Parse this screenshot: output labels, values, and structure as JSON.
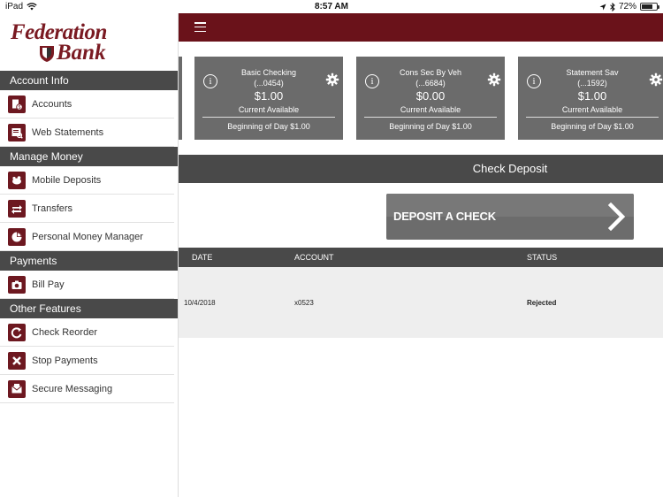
{
  "status_bar": {
    "device": "iPad",
    "time": "8:57 AM",
    "battery": "72%",
    "battery_level": 0.72
  },
  "logo": {
    "line1": "Federation",
    "line2": "Bank"
  },
  "sidebar": {
    "sections": [
      {
        "title": "Account Info",
        "items": [
          {
            "label": "Accounts",
            "icon": "accounts-icon"
          },
          {
            "label": "Web Statements",
            "icon": "web-statements-icon"
          }
        ]
      },
      {
        "title": "Manage Money",
        "items": [
          {
            "label": "Mobile Deposits",
            "icon": "mobile-deposits-icon"
          },
          {
            "label": "Transfers",
            "icon": "transfers-icon"
          },
          {
            "label": "Personal Money Manager",
            "icon": "pie-chart-icon"
          }
        ]
      },
      {
        "title": "Payments",
        "items": [
          {
            "label": "Bill Pay",
            "icon": "camera-icon"
          }
        ]
      },
      {
        "title": "Other Features",
        "items": [
          {
            "label": "Check Reorder",
            "icon": "reorder-icon"
          },
          {
            "label": "Stop Payments",
            "icon": "close-icon"
          },
          {
            "label": "Secure Messaging",
            "icon": "envelope-icon"
          }
        ]
      }
    ]
  },
  "accounts": [
    {
      "name": "Basic Checking",
      "number": "(...0454)",
      "amount": "$1.00",
      "label": "Current Available",
      "beginning": "Beginning of Day $1.00"
    },
    {
      "name": "Cons Sec By Veh",
      "number": "(...6684)",
      "amount": "$0.00",
      "label": "Current Available",
      "beginning": "Beginning of Day $1.00"
    },
    {
      "name": "Statement Sav",
      "number": "(...1592)",
      "amount": "$1.00",
      "label": "Current Available",
      "beginning": "Beginning of Day $1.00"
    }
  ],
  "check_deposit": {
    "title": "Check Deposit",
    "button_label": "DEPOSIT A CHECK"
  },
  "history_table": {
    "columns": [
      "DATE",
      "ACCOUNT",
      "STATUS"
    ],
    "rows": [
      {
        "date": "10/4/2018",
        "account": "x0523",
        "status": "Rejected"
      }
    ]
  },
  "colors": {
    "brand": "#6a121a",
    "header_gray": "#494949",
    "card_gray": "#6b6b6b"
  }
}
